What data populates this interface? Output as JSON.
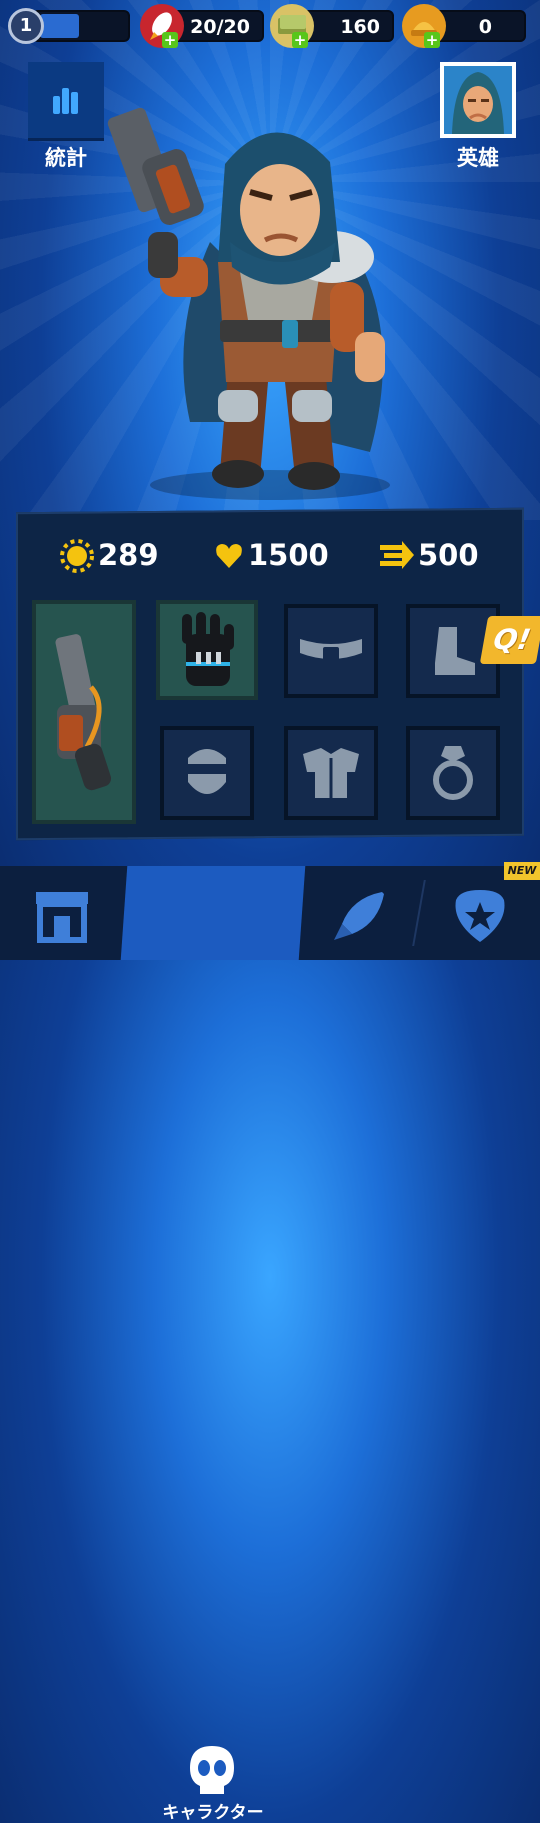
{
  "topbar": {
    "level": "1",
    "xp_progress": 0.45,
    "energy": "20/20",
    "cash": "160",
    "gold": "0"
  },
  "buttons": {
    "stats_label": "統計",
    "hero_label": "英雄"
  },
  "stats": {
    "power": "289",
    "health": "1500",
    "speed": "500"
  },
  "equipment": {
    "slots": [
      "revolver",
      "glove",
      "belt",
      "boot",
      "mask",
      "armor",
      "ring"
    ]
  },
  "quest_badge": "Q!",
  "nav": {
    "items": [
      "shop",
      "character",
      "missions",
      "achievements"
    ],
    "active_label": "キャラクター",
    "new_badge": "NEW"
  },
  "colors": {
    "accent_green": "#58c61a",
    "star_yellow": "#f2c52c",
    "active_nav": "#1c5bc0"
  }
}
